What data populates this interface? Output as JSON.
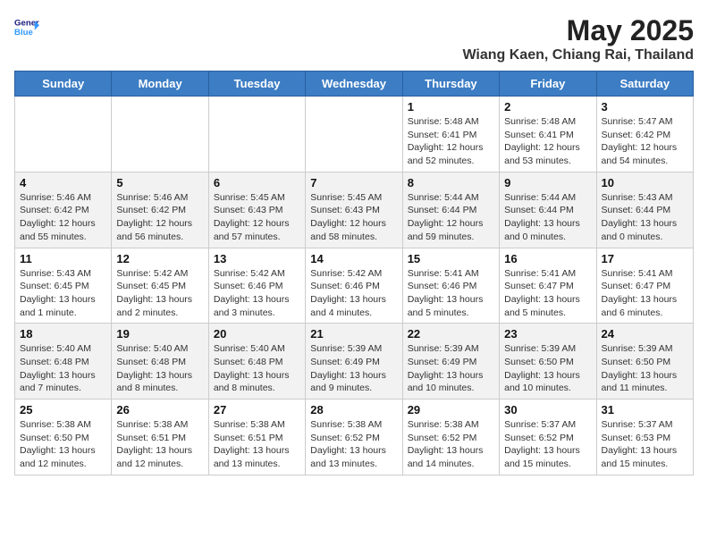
{
  "header": {
    "logo_line1": "General",
    "logo_line2": "Blue",
    "title": "May 2025",
    "subtitle": "Wiang Kaen, Chiang Rai, Thailand"
  },
  "days_of_week": [
    "Sunday",
    "Monday",
    "Tuesday",
    "Wednesday",
    "Thursday",
    "Friday",
    "Saturday"
  ],
  "weeks": [
    [
      {
        "day": "",
        "info": ""
      },
      {
        "day": "",
        "info": ""
      },
      {
        "day": "",
        "info": ""
      },
      {
        "day": "",
        "info": ""
      },
      {
        "day": "1",
        "info": "Sunrise: 5:48 AM\nSunset: 6:41 PM\nDaylight: 12 hours\nand 52 minutes."
      },
      {
        "day": "2",
        "info": "Sunrise: 5:48 AM\nSunset: 6:41 PM\nDaylight: 12 hours\nand 53 minutes."
      },
      {
        "day": "3",
        "info": "Sunrise: 5:47 AM\nSunset: 6:42 PM\nDaylight: 12 hours\nand 54 minutes."
      }
    ],
    [
      {
        "day": "4",
        "info": "Sunrise: 5:46 AM\nSunset: 6:42 PM\nDaylight: 12 hours\nand 55 minutes."
      },
      {
        "day": "5",
        "info": "Sunrise: 5:46 AM\nSunset: 6:42 PM\nDaylight: 12 hours\nand 56 minutes."
      },
      {
        "day": "6",
        "info": "Sunrise: 5:45 AM\nSunset: 6:43 PM\nDaylight: 12 hours\nand 57 minutes."
      },
      {
        "day": "7",
        "info": "Sunrise: 5:45 AM\nSunset: 6:43 PM\nDaylight: 12 hours\nand 58 minutes."
      },
      {
        "day": "8",
        "info": "Sunrise: 5:44 AM\nSunset: 6:44 PM\nDaylight: 12 hours\nand 59 minutes."
      },
      {
        "day": "9",
        "info": "Sunrise: 5:44 AM\nSunset: 6:44 PM\nDaylight: 13 hours\nand 0 minutes."
      },
      {
        "day": "10",
        "info": "Sunrise: 5:43 AM\nSunset: 6:44 PM\nDaylight: 13 hours\nand 0 minutes."
      }
    ],
    [
      {
        "day": "11",
        "info": "Sunrise: 5:43 AM\nSunset: 6:45 PM\nDaylight: 13 hours\nand 1 minute."
      },
      {
        "day": "12",
        "info": "Sunrise: 5:42 AM\nSunset: 6:45 PM\nDaylight: 13 hours\nand 2 minutes."
      },
      {
        "day": "13",
        "info": "Sunrise: 5:42 AM\nSunset: 6:46 PM\nDaylight: 13 hours\nand 3 minutes."
      },
      {
        "day": "14",
        "info": "Sunrise: 5:42 AM\nSunset: 6:46 PM\nDaylight: 13 hours\nand 4 minutes."
      },
      {
        "day": "15",
        "info": "Sunrise: 5:41 AM\nSunset: 6:46 PM\nDaylight: 13 hours\nand 5 minutes."
      },
      {
        "day": "16",
        "info": "Sunrise: 5:41 AM\nSunset: 6:47 PM\nDaylight: 13 hours\nand 5 minutes."
      },
      {
        "day": "17",
        "info": "Sunrise: 5:41 AM\nSunset: 6:47 PM\nDaylight: 13 hours\nand 6 minutes."
      }
    ],
    [
      {
        "day": "18",
        "info": "Sunrise: 5:40 AM\nSunset: 6:48 PM\nDaylight: 13 hours\nand 7 minutes."
      },
      {
        "day": "19",
        "info": "Sunrise: 5:40 AM\nSunset: 6:48 PM\nDaylight: 13 hours\nand 8 minutes."
      },
      {
        "day": "20",
        "info": "Sunrise: 5:40 AM\nSunset: 6:48 PM\nDaylight: 13 hours\nand 8 minutes."
      },
      {
        "day": "21",
        "info": "Sunrise: 5:39 AM\nSunset: 6:49 PM\nDaylight: 13 hours\nand 9 minutes."
      },
      {
        "day": "22",
        "info": "Sunrise: 5:39 AM\nSunset: 6:49 PM\nDaylight: 13 hours\nand 10 minutes."
      },
      {
        "day": "23",
        "info": "Sunrise: 5:39 AM\nSunset: 6:50 PM\nDaylight: 13 hours\nand 10 minutes."
      },
      {
        "day": "24",
        "info": "Sunrise: 5:39 AM\nSunset: 6:50 PM\nDaylight: 13 hours\nand 11 minutes."
      }
    ],
    [
      {
        "day": "25",
        "info": "Sunrise: 5:38 AM\nSunset: 6:50 PM\nDaylight: 13 hours\nand 12 minutes."
      },
      {
        "day": "26",
        "info": "Sunrise: 5:38 AM\nSunset: 6:51 PM\nDaylight: 13 hours\nand 12 minutes."
      },
      {
        "day": "27",
        "info": "Sunrise: 5:38 AM\nSunset: 6:51 PM\nDaylight: 13 hours\nand 13 minutes."
      },
      {
        "day": "28",
        "info": "Sunrise: 5:38 AM\nSunset: 6:52 PM\nDaylight: 13 hours\nand 13 minutes."
      },
      {
        "day": "29",
        "info": "Sunrise: 5:38 AM\nSunset: 6:52 PM\nDaylight: 13 hours\nand 14 minutes."
      },
      {
        "day": "30",
        "info": "Sunrise: 5:37 AM\nSunset: 6:52 PM\nDaylight: 13 hours\nand 15 minutes."
      },
      {
        "day": "31",
        "info": "Sunrise: 5:37 AM\nSunset: 6:53 PM\nDaylight: 13 hours\nand 15 minutes."
      }
    ]
  ]
}
